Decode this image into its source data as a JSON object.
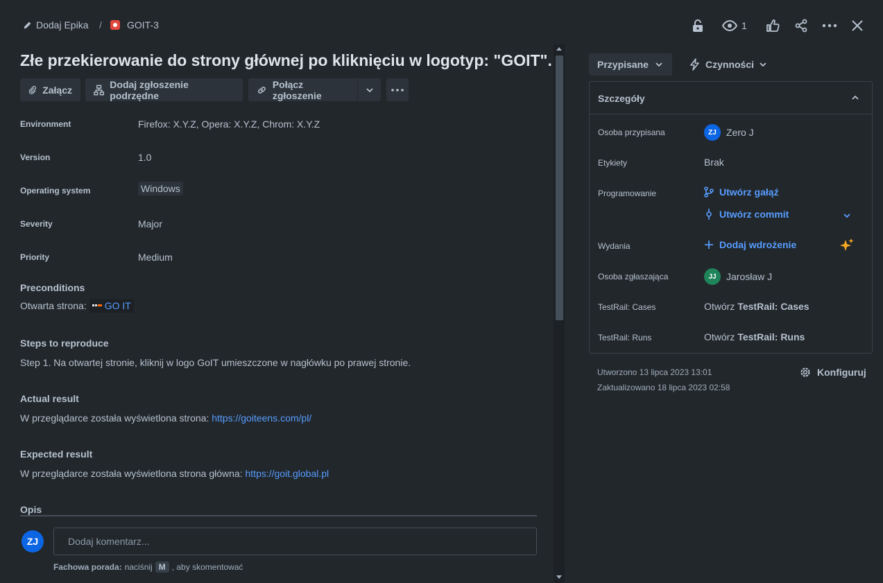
{
  "breadcrumb": {
    "epic_label": "Dodaj Epika",
    "separator": "/",
    "issue_key": "GOIT-3"
  },
  "top_actions": {
    "watch_count": "1"
  },
  "issue": {
    "title": "Złe przekierowanie do strony głównej po kliknięciu w logotyp: \"GOIT\"."
  },
  "toolbar": {
    "attach": "Załącz",
    "add_child": "Dodaj zgłoszenie podrzędne",
    "link_issue": "Połącz zgłoszenie"
  },
  "fields": [
    {
      "label": "Environment",
      "value": "Firefox: X.Y.Z, Opera: X.Y.Z, Chrom: X.Y.Z"
    },
    {
      "label": "Version",
      "value": "1.0"
    },
    {
      "label": "Operating system",
      "value": "Windows"
    },
    {
      "label": "Severity",
      "value": "Major"
    },
    {
      "label": "Priority",
      "value": "Medium"
    }
  ],
  "sections": {
    "preconditions": {
      "heading": "Preconditions",
      "text": "Otwarta strona:",
      "link": "GO IT"
    },
    "steps": {
      "heading": "Steps to reproduce",
      "text": "Step 1. Na otwartej stronie, kliknij w logo GoIT umieszczone w nagłówku po prawej stronie."
    },
    "actual": {
      "heading": "Actual result",
      "text": "W przeglądarce została wyświetlona strona:",
      "link": "https://goiteens.com/pl/"
    },
    "expected": {
      "heading": "Expected result",
      "text": "W przeglądarce została wyświetlona strona główna:",
      "link": "https://goit.global.pl"
    },
    "description": {
      "heading": "Opis"
    }
  },
  "comment": {
    "avatar_initials": "ZJ",
    "placeholder": "Dodaj komentarz...",
    "tip_label": "Fachowa porada:",
    "tip_pre": "naciśnij",
    "tip_key": "M",
    "tip_post": ", aby skomentować"
  },
  "side": {
    "status": "Przypisane",
    "actions": "Czynności",
    "details_title": "Szczegóły",
    "assignee": {
      "label": "Osoba przypisana",
      "initials": "ZJ",
      "name": "Zero J"
    },
    "labels": {
      "label": "Etykiety",
      "value": "Brak"
    },
    "development": {
      "label": "Programowanie",
      "branch": "Utwórz gałąź",
      "commit": "Utwórz commit"
    },
    "releases": {
      "label": "Wydania",
      "value": "Dodaj wdrożenie"
    },
    "reporter": {
      "label": "Osoba zgłaszająca",
      "initials": "JJ",
      "name": "Jarosław J"
    },
    "testrail_cases": {
      "label": "TestRail: Cases",
      "prefix": "Otwórz",
      "value": "TestRail: Cases"
    },
    "testrail_runs": {
      "label": "TestRail: Runs",
      "prefix": "Otwórz",
      "value": "TestRail: Runs"
    },
    "created": "Utworzono 13 lipca 2023 13:01",
    "updated": "Zaktualizowano 18 lipca 2023 02:58",
    "configure": "Konfiguruj"
  },
  "colors": {
    "background": "#22272b",
    "button_bg": "#2c333a",
    "link": "#579dff",
    "bug_icon": "#e2483d",
    "avatar_zj": "#0c66e4",
    "avatar_jj": "#1f845a",
    "sparkle": "#f5a623"
  }
}
